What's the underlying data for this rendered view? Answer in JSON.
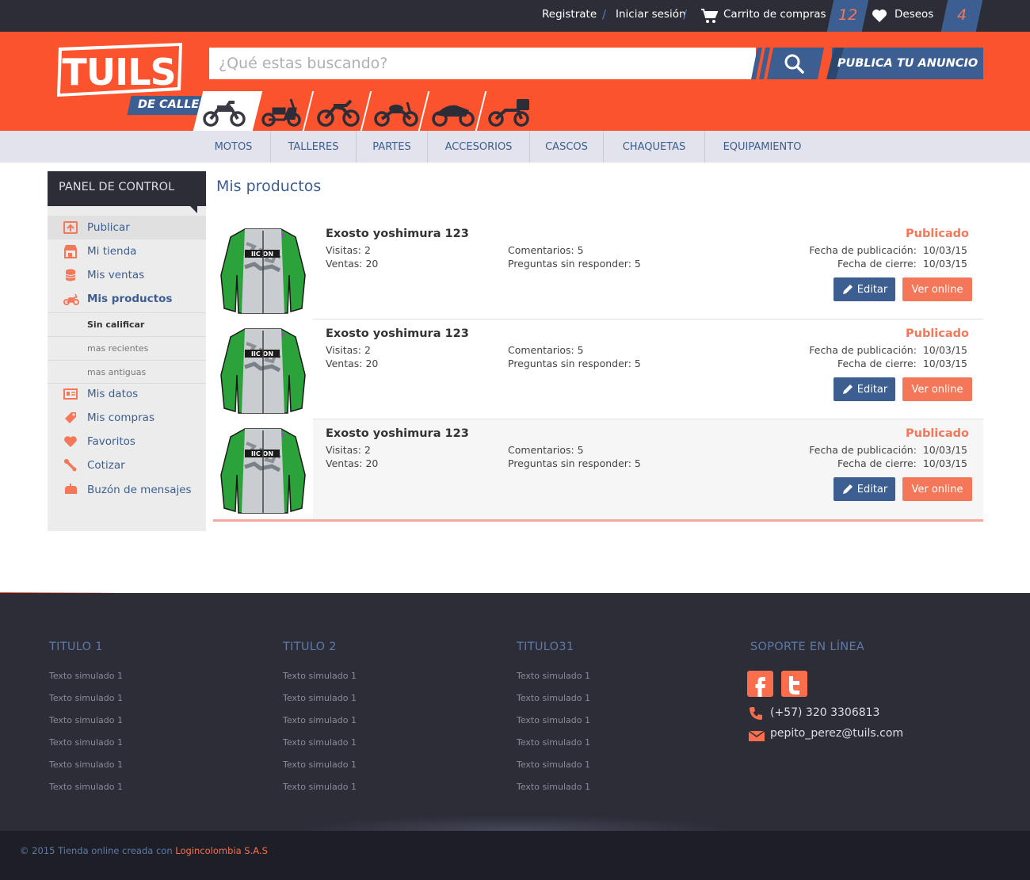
{
  "topbar": {
    "register": "Registrate",
    "login": "Iniciar sesión",
    "cart_label": "Carrito de compras",
    "cart_count": "12",
    "wishlist_label": "Deseos",
    "wishlist_count": "4"
  },
  "header": {
    "logo_text": "TUILS",
    "logo_sub": "DE CALLE",
    "search_placeholder": "¿Qué estas buscando?",
    "publish_label": "PUBLICA TU ANUNCIO"
  },
  "nav": {
    "items": [
      "MOTOS",
      "TALLERES",
      "PARTES",
      "ACCESORIOS",
      "CASCOS",
      "CHAQUETAS",
      "EQUIPAMIENTO"
    ]
  },
  "sidebar": {
    "title": "PANEL DE CONTROL",
    "items": [
      {
        "label": "Publicar",
        "icon": "upload-icon"
      },
      {
        "label": "Mi tienda",
        "icon": "store-icon"
      },
      {
        "label": "Mis ventas",
        "icon": "coins-icon"
      },
      {
        "label": "Mis productos",
        "icon": "scooter-icon"
      },
      {
        "label": "Mis datos",
        "icon": "id-card-icon"
      },
      {
        "label": "Mis compras",
        "icon": "tag-icon"
      },
      {
        "label": "Favoritos",
        "icon": "heart-icon"
      },
      {
        "label": "Cotizar",
        "icon": "wrench-icon"
      },
      {
        "label": "Buzón de mensajes",
        "icon": "mailbox-icon"
      }
    ],
    "subitems": [
      "Sin calificar",
      "mas recientes",
      "mas antiguas"
    ]
  },
  "main": {
    "title": "Mis productos",
    "products": [
      {
        "name": "Exosto yoshimura 123",
        "visits": "Visitas: 2",
        "sales": "Ventas: 20",
        "comments": "Comentarios: 5",
        "questions": "Preguntas sin responder: 5",
        "status": "Publicado",
        "pub_label": "Fecha de publicación:",
        "pub_date": "10/03/15",
        "close_label": "Fecha de cierre:",
        "close_date": "10/03/15",
        "edit_label": "Editar",
        "view_label": "Ver online"
      },
      {
        "name": "Exosto yoshimura 123",
        "visits": "Visitas: 2",
        "sales": "Ventas: 20",
        "comments": "Comentarios: 5",
        "questions": "Preguntas sin responder: 5",
        "status": "Publicado",
        "pub_label": "Fecha de publicación:",
        "pub_date": "10/03/15",
        "close_label": "Fecha de cierre:",
        "close_date": "10/03/15",
        "edit_label": "Editar",
        "view_label": "Ver online"
      },
      {
        "name": "Exosto yoshimura 123",
        "visits": "Visitas: 2",
        "sales": "Ventas: 20",
        "comments": "Comentarios: 5",
        "questions": "Preguntas sin responder: 5",
        "status": "Publicado",
        "pub_label": "Fecha de publicación:",
        "pub_date": "10/03/15",
        "close_label": "Fecha de cierre:",
        "close_date": "10/03/15",
        "edit_label": "Editar",
        "view_label": "Ver online"
      }
    ]
  },
  "footer": {
    "columns": [
      {
        "title": "TITULO 1",
        "links": [
          "Texto simulado 1",
          "Texto simulado 1",
          "Texto simulado 1",
          "Texto simulado 1",
          "Texto simulado 1",
          "Texto simulado 1"
        ]
      },
      {
        "title": "TITULO 2",
        "links": [
          "Texto simulado 1",
          "Texto simulado 1",
          "Texto simulado 1",
          "Texto simulado 1",
          "Texto simulado 1",
          "Texto simulado 1"
        ]
      },
      {
        "title": "TITULO31",
        "links": [
          "Texto simulado 1",
          "Texto simulado 1",
          "Texto simulado 1",
          "Texto simulado 1",
          "Texto simulado 1",
          "Texto simulado 1"
        ]
      }
    ],
    "support_title": "SOPORTE EN LÍNEA",
    "phone": "(+57) 320 3306813",
    "email": "pepito_perez@tuils.com",
    "copyright_prefix": "© 2015 Tienda online creada con",
    "copyright_company": "Logincolombia S.A.S"
  },
  "colors": {
    "brand_orange": "#fa532d",
    "brand_blue": "#3d5e90",
    "accent_salmon": "#f4775a",
    "dark": "#2d2d38"
  }
}
